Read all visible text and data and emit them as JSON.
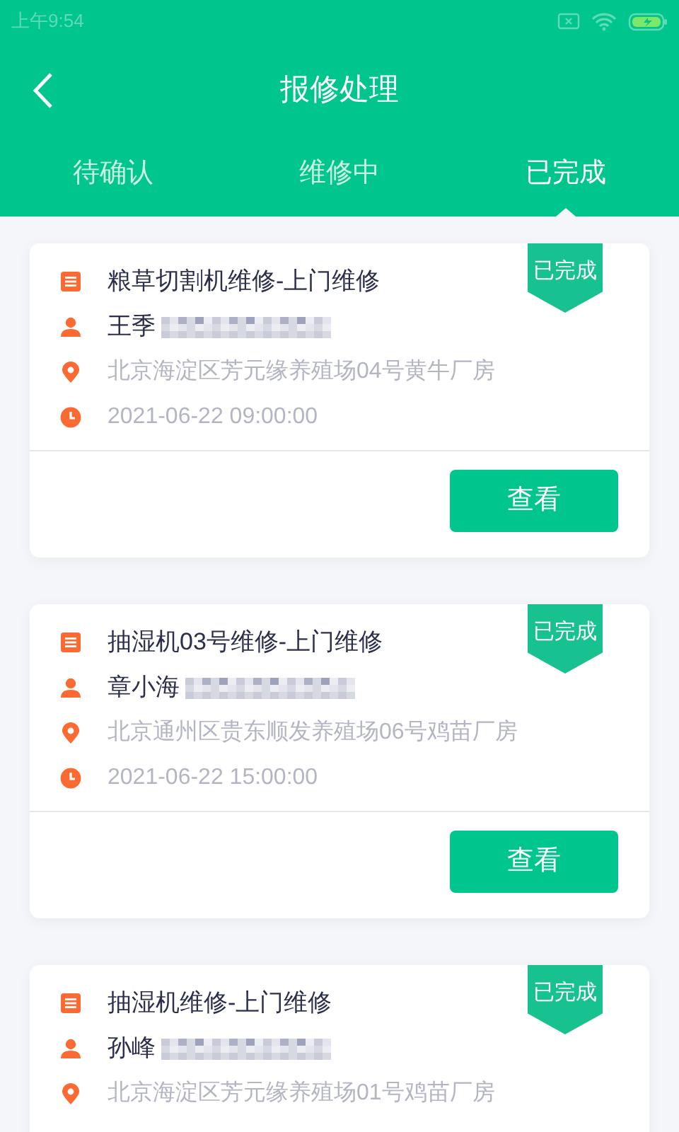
{
  "status_bar": {
    "time": "上午9:54"
  },
  "header": {
    "title": "报修处理"
  },
  "tabs": [
    {
      "label": "待确认",
      "selected": false
    },
    {
      "label": "维修中",
      "selected": false
    },
    {
      "label": "已完成",
      "selected": true
    }
  ],
  "orders": [
    {
      "title": "粮草切割机维修-上门维修",
      "badge": "已完成",
      "contact": "王季",
      "phone_redacted": true,
      "address": "北京海淀区芳元缘养殖场04号黄牛厂房",
      "time": "2021-06-22 09:00:00",
      "action": "查看"
    },
    {
      "title": "抽湿机03号维修-上门维修",
      "badge": "已完成",
      "contact": "章小海",
      "phone_redacted": true,
      "address": "北京通州区贵东顺发养殖场06号鸡苗厂房",
      "time": "2021-06-22 15:00:00",
      "action": "查看"
    },
    {
      "title": "抽湿机维修-上门维修",
      "badge": "已完成",
      "contact": "孙峰",
      "phone_redacted": true,
      "address": "北京海淀区芳元缘养殖场01号鸡苗厂房"
    }
  ]
}
